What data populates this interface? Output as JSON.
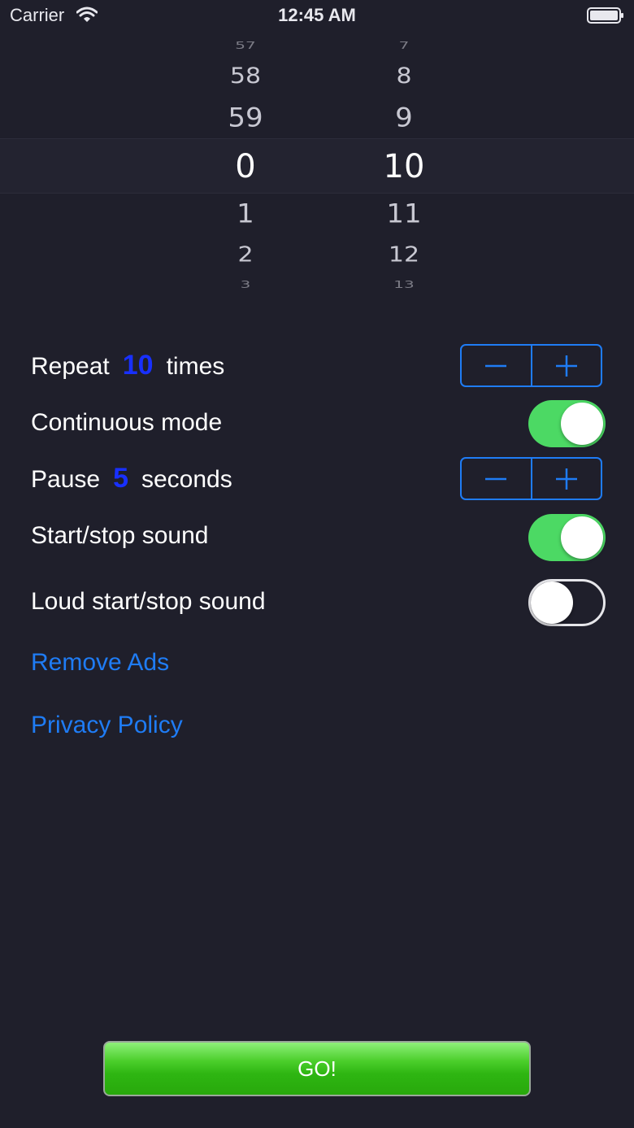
{
  "status_bar": {
    "carrier": "Carrier",
    "time": "12:45 AM",
    "icons": [
      "wifi-icon",
      "battery-icon"
    ]
  },
  "picker": {
    "minutes": [
      "57",
      "58",
      "59",
      "0",
      "1",
      "2",
      "3"
    ],
    "seconds": [
      "7",
      "8",
      "9",
      "10",
      "11",
      "12",
      "13"
    ],
    "selected_minutes": "0",
    "selected_seconds": "10"
  },
  "settings": {
    "repeat": {
      "prefix": "Repeat",
      "value": "10",
      "suffix": "times"
    },
    "continuous": {
      "label": "Continuous mode",
      "on": true
    },
    "pause": {
      "prefix": "Pause",
      "value": "5",
      "suffix": "seconds"
    },
    "start_stop_sound": {
      "label": "Start/stop sound",
      "on": true
    },
    "loud_sound": {
      "label": "Loud start/stop sound",
      "on": false
    }
  },
  "links": {
    "remove_ads": "Remove Ads",
    "privacy_policy": "Privacy Policy"
  },
  "go_button": {
    "label": "GO!"
  },
  "colors": {
    "background": "#1f1f2b",
    "accent_blue": "#1f7cf5",
    "value_blue": "#1830ff",
    "toggle_green": "#4cd964",
    "go_green": "#2eb612"
  }
}
